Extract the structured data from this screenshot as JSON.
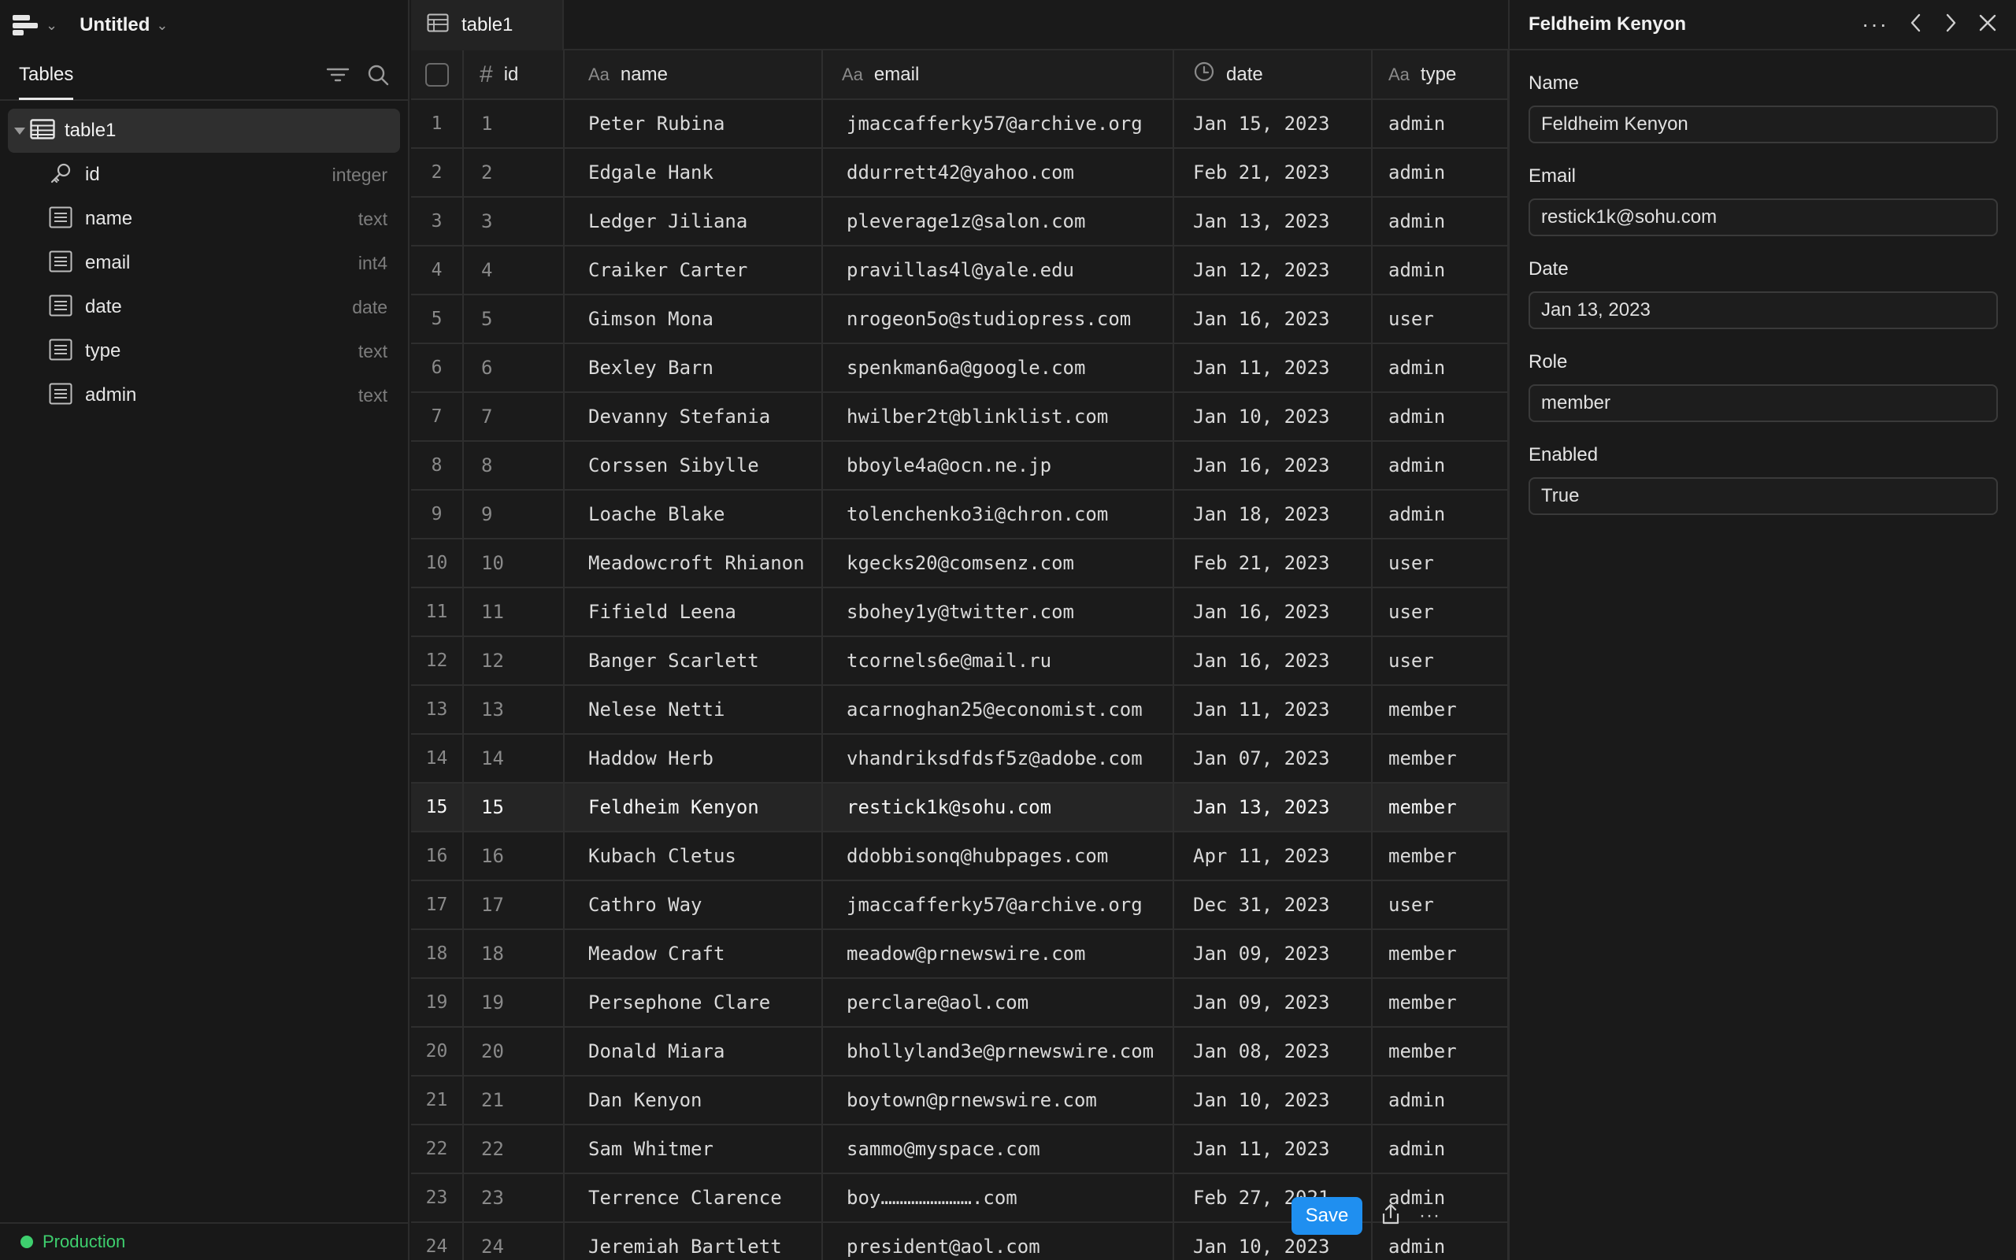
{
  "app": {
    "project_title": "Untitled",
    "environment": "Production",
    "env_color": "#3ecf6e"
  },
  "sidebar": {
    "tab_label": "Tables",
    "table": {
      "label": "table1"
    },
    "columns": [
      {
        "name": "id",
        "type": "integer",
        "icon": "key-icon"
      },
      {
        "name": "name",
        "type": "text",
        "icon": "text-field-icon"
      },
      {
        "name": "email",
        "type": "int4",
        "icon": "text-field-icon"
      },
      {
        "name": "date",
        "type": "date",
        "icon": "text-field-icon"
      },
      {
        "name": "type",
        "type": "text",
        "icon": "text-field-icon"
      },
      {
        "name": "admin",
        "type": "text",
        "icon": "text-field-icon"
      }
    ]
  },
  "main": {
    "tab_label": "table1",
    "headers": {
      "id": "id",
      "name": "name",
      "email": "email",
      "date": "date",
      "type": "type"
    },
    "selected_row": 15,
    "rows": [
      [
        "1",
        "1",
        "Peter Rubina",
        "jmaccafferky57@archive.org",
        "Jan 15, 2023",
        "admin"
      ],
      [
        "2",
        "2",
        "Edgale Hank",
        "ddurrett42@yahoo.com",
        "Feb 21, 2023",
        "admin"
      ],
      [
        "3",
        "3",
        "Ledger Jiliana",
        "pleverage1z@salon.com",
        "Jan 13, 2023",
        "admin"
      ],
      [
        "4",
        "4",
        "Craiker Carter",
        "pravillas4l@yale.edu",
        "Jan 12, 2023",
        "admin"
      ],
      [
        "5",
        "5",
        "Gimson Mona",
        "nrogeon5o@studiopress.com",
        "Jan 16, 2023",
        "user"
      ],
      [
        "6",
        "6",
        "Bexley Barn",
        "spenkman6a@google.com",
        "Jan 11, 2023",
        "admin"
      ],
      [
        "7",
        "7",
        "Devanny Stefania",
        "hwilber2t@blinklist.com",
        "Jan 10, 2023",
        "admin"
      ],
      [
        "8",
        "8",
        "Corssen Sibylle",
        "bboyle4a@ocn.ne.jp",
        "Jan 16, 2023",
        "admin"
      ],
      [
        "9",
        "9",
        "Loache Blake",
        "tolenchenko3i@chron.com",
        "Jan 18, 2023",
        "admin"
      ],
      [
        "10",
        "10",
        "Meadowcroft Rhianon",
        "kgecks20@comsenz.com",
        "Feb 21, 2023",
        "user"
      ],
      [
        "11",
        "11",
        "Fifield Leena",
        "sbohey1y@twitter.com",
        "Jan 16, 2023",
        "user"
      ],
      [
        "12",
        "12",
        "Banger Scarlett",
        "tcornels6e@mail.ru",
        "Jan 16, 2023",
        "user"
      ],
      [
        "13",
        "13",
        "Nelese Netti",
        "acarnoghan25@economist.com",
        "Jan 11, 2023",
        "member"
      ],
      [
        "14",
        "14",
        "Haddow Herb",
        "vhandriksdfdsf5z@adobe.com",
        "Jan 07, 2023",
        "member"
      ],
      [
        "15",
        "15",
        "Feldheim Kenyon",
        "restick1k@sohu.com",
        "Jan 13, 2023",
        "member"
      ],
      [
        "16",
        "16",
        "Kubach Cletus",
        "ddobbisonq@hubpages.com",
        "Apr 11, 2023",
        "member"
      ],
      [
        "17",
        "17",
        "Cathro Way",
        "jmaccafferky57@archive.org",
        "Dec 31, 2023",
        "user"
      ],
      [
        "18",
        "18",
        "Meadow Craft",
        "meadow@prnewswire.com",
        "Jan 09, 2023",
        "member"
      ],
      [
        "19",
        "19",
        "Persephone Clare",
        "perclare@aol.com",
        "Jan 09, 2023",
        "member"
      ],
      [
        "20",
        "20",
        "Donald Miara",
        "bhollyland3e@prnewswire.com",
        "Jan 08, 2023",
        "member"
      ],
      [
        "21",
        "21",
        "Dan Kenyon",
        "boytown@prnewswire.com",
        "Jan 10, 2023",
        "admin"
      ],
      [
        "22",
        "22",
        "Sam Whitmer",
        "sammo@myspace.com",
        "Jan 11, 2023",
        "admin"
      ],
      [
        "23",
        "23",
        "Terrence Clarence",
        "boy…………………….com",
        "Feb 27, 2021",
        "admin"
      ],
      [
        "24",
        "24",
        "Jeremiah Bartlett",
        "president@aol.com",
        "Jan 10, 2023",
        "admin"
      ]
    ]
  },
  "toolbar": {
    "save_label": "Save",
    "more_label": "···",
    "accent": "#1f8ff0"
  },
  "panel": {
    "title": "Feldheim Kenyon",
    "fields": [
      {
        "label": "Name",
        "value": "Feldheim Kenyon"
      },
      {
        "label": "Email",
        "value": "restick1k@sohu.com"
      },
      {
        "label": "Date",
        "value": "Jan 13, 2023"
      },
      {
        "label": "Role",
        "value": "member"
      },
      {
        "label": "Enabled",
        "value": "True"
      }
    ]
  }
}
